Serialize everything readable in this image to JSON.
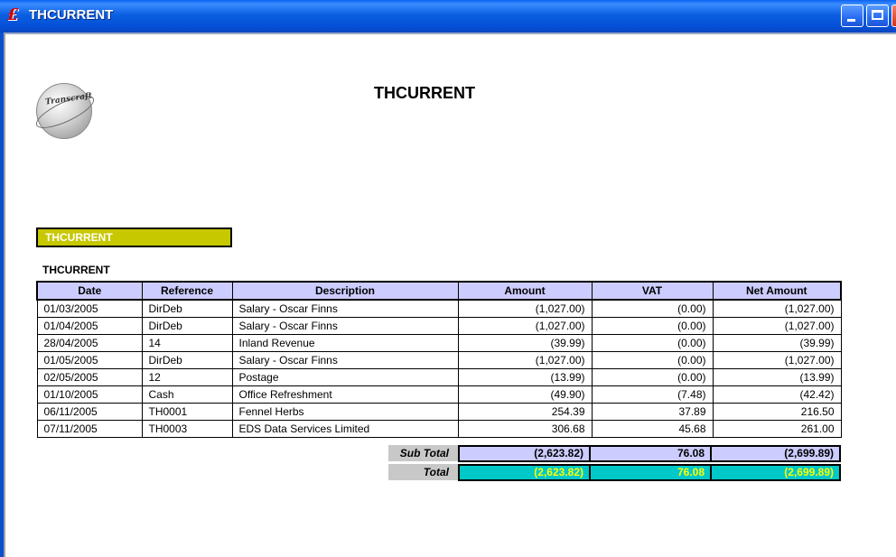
{
  "window": {
    "title": "THCURRENT",
    "app_icon_glyph": "£",
    "controls": [
      "minimize-icon",
      "maximize-icon",
      "close-icon"
    ]
  },
  "report": {
    "logo_text": "Transcraft",
    "title": "THCURRENT",
    "group_header": "THCURRENT",
    "sub_header": "THCURRENT",
    "colors": {
      "header_bg": "#ccccff",
      "group_bg": "#c8c800",
      "total_bg": "#00c8c8",
      "total_text": "#ffff00"
    },
    "columns": [
      "Date",
      "Reference",
      "Description",
      "Amount",
      "VAT",
      "Net Amount"
    ],
    "rows": [
      [
        "01/03/2005",
        "DirDeb",
        "Salary - Oscar Finns",
        "(1,027.00)",
        "(0.00)",
        "(1,027.00)"
      ],
      [
        "01/04/2005",
        "DirDeb",
        "Salary - Oscar Finns",
        "(1,027.00)",
        "(0.00)",
        "(1,027.00)"
      ],
      [
        "28/04/2005",
        "14",
        "Inland Revenue",
        "(39.99)",
        "(0.00)",
        "(39.99)"
      ],
      [
        "01/05/2005",
        "DirDeb",
        "Salary - Oscar Finns",
        "(1,027.00)",
        "(0.00)",
        "(1,027.00)"
      ],
      [
        "02/05/2005",
        "12",
        "Postage",
        "(13.99)",
        "(0.00)",
        "(13.99)"
      ],
      [
        "01/10/2005",
        "Cash",
        "Office Refreshment",
        "(49.90)",
        "(7.48)",
        "(42.42)"
      ],
      [
        "06/11/2005",
        "TH0001",
        "Fennel Herbs",
        "254.39",
        "37.89",
        "216.50"
      ],
      [
        "07/11/2005",
        "TH0003",
        "EDS Data Services Limited",
        "306.68",
        "45.68",
        "261.00"
      ]
    ],
    "subtotal": {
      "label": "Sub Total",
      "amount": "(2,623.82)",
      "vat": "76.08",
      "net": "(2,699.89)"
    },
    "total": {
      "label": "Total",
      "amount": "(2,623.82)",
      "vat": "76.08",
      "net": "(2,699.89)"
    }
  }
}
